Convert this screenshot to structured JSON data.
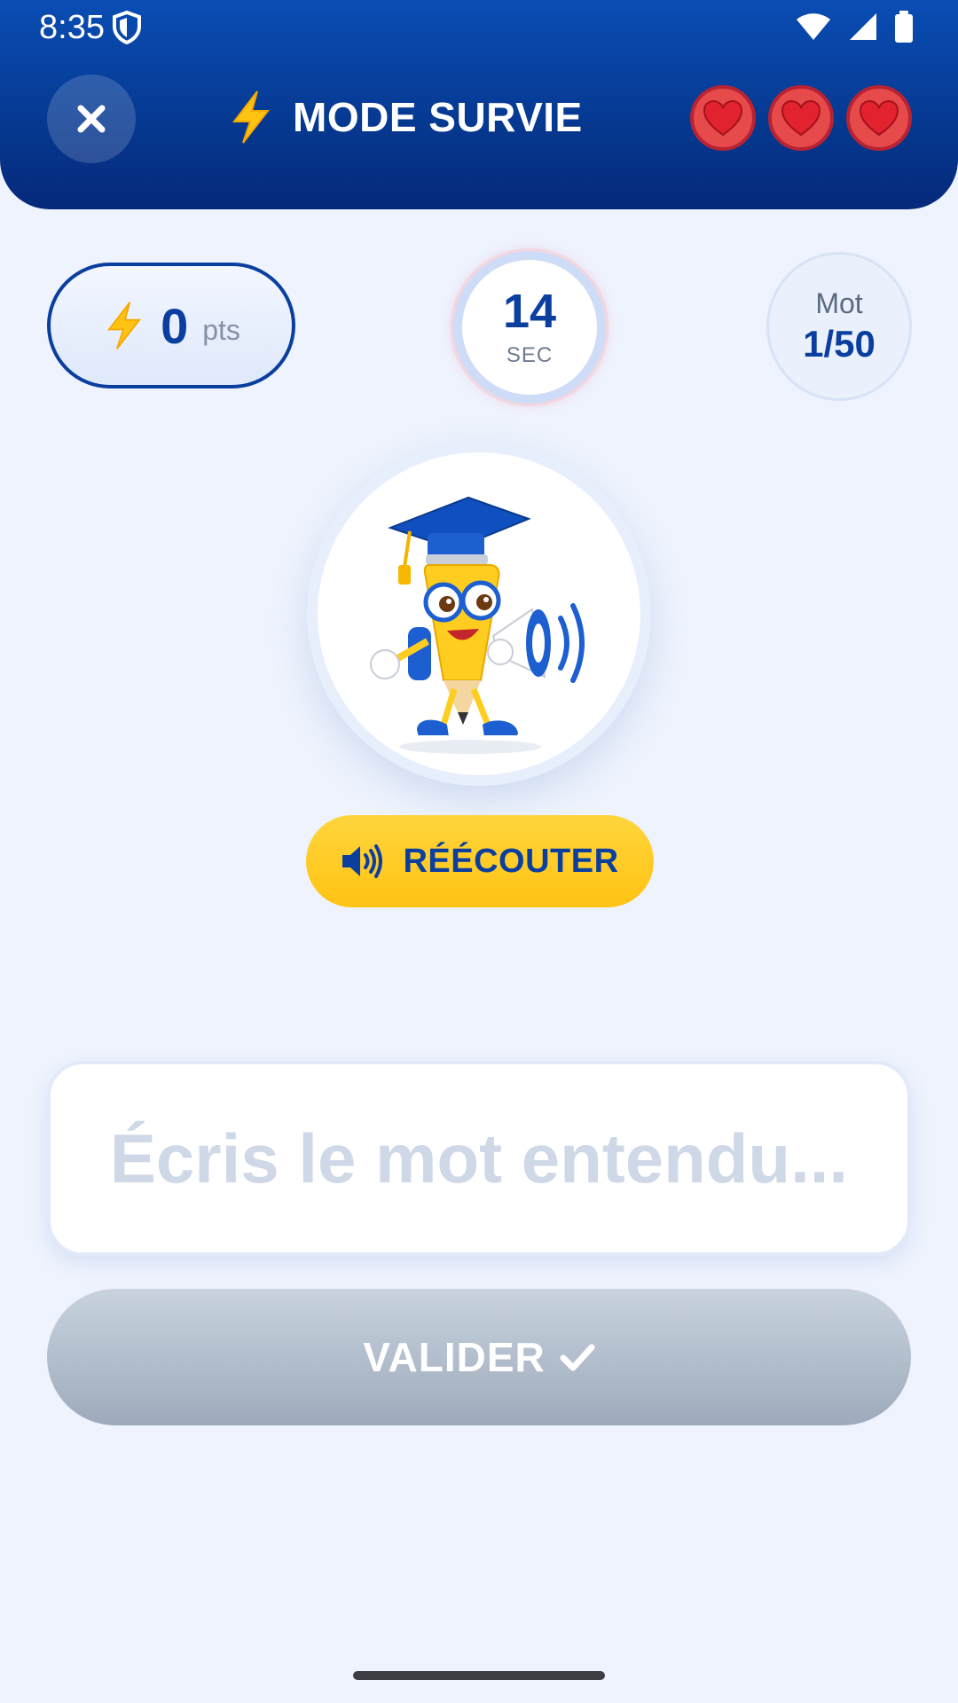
{
  "status_bar": {
    "time": "8:35"
  },
  "header": {
    "title": "MODE SURVIE",
    "title_icon": "lightning-icon",
    "close_icon": "close-icon",
    "lives": [
      {
        "icon": "heart-icon"
      },
      {
        "icon": "heart-icon"
      },
      {
        "icon": "heart-icon"
      }
    ]
  },
  "stats": {
    "points_value": "0",
    "points_unit": "pts",
    "timer_value": "14",
    "timer_unit": "SEC",
    "word_label": "Mot",
    "word_value": "1/50"
  },
  "replay": {
    "label": "RÉÉCOUTER",
    "icon": "speaker-icon"
  },
  "answer": {
    "placeholder": "Écris le mot entendu...",
    "value": ""
  },
  "validate": {
    "label": "VALIDER",
    "icon": "check-icon"
  },
  "colors": {
    "primary": "#0b3f9f",
    "accent": "#ffc313",
    "heart": "#e74a4a",
    "background": "#eef3fd",
    "disabled_button": "#9eaabb"
  }
}
